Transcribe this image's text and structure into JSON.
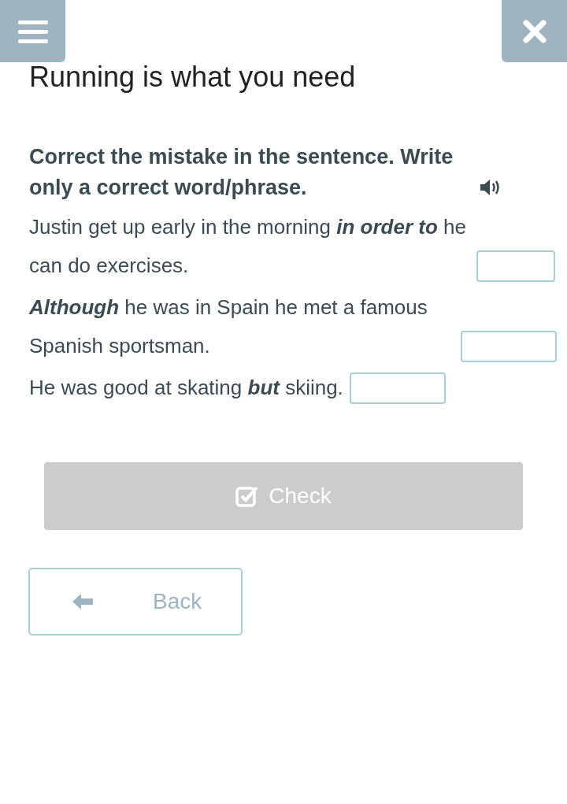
{
  "title": "Running is what you need",
  "instruction": "Correct the mistake in the sentence. Write only a correct word/phrase.",
  "sentences": [
    {
      "text": "Justin get up early in the morning **in order to** he can do exercises."
    },
    {
      "text": "**Although** he was in Spain he met a famous Spanish sportsman."
    },
    {
      "text": "He was good at skating **but** skiing."
    }
  ],
  "check_button": {
    "label": "Check",
    "disabled": true
  },
  "back_button": {
    "label": "Back"
  }
}
